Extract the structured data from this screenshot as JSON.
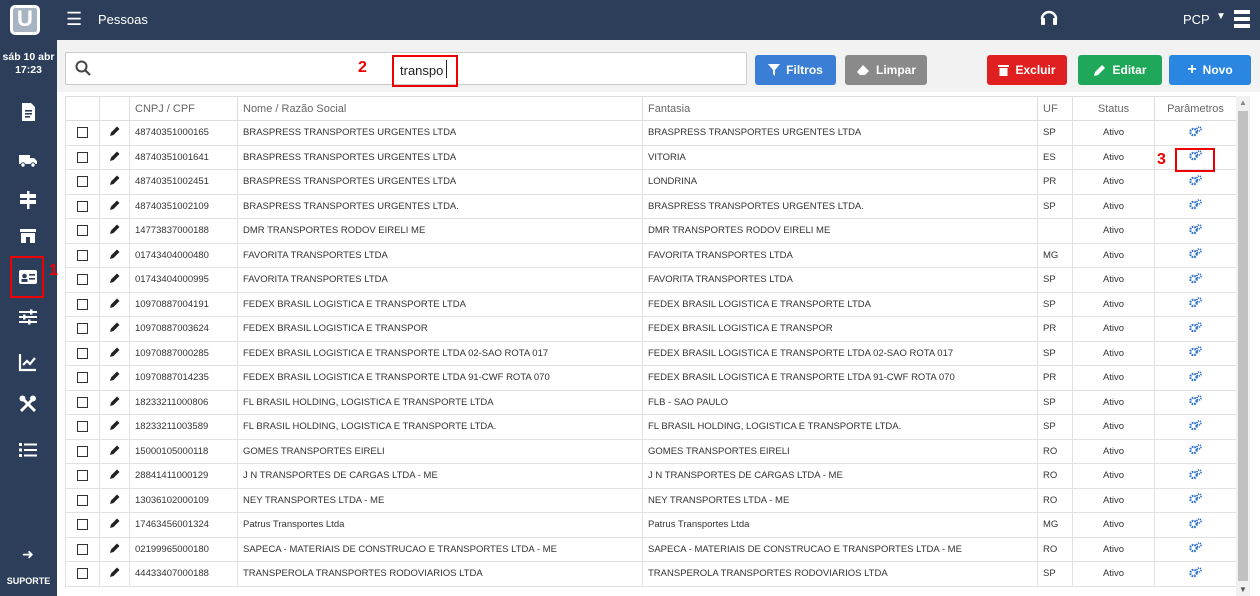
{
  "header": {
    "logo_text": "U",
    "title": "Pessoas",
    "user_label": "PCP"
  },
  "sidebar": {
    "date_line1": "sáb 10 abr",
    "date_line2": "17:23",
    "items": [
      "document-icon",
      "truck-icon",
      "signpost-icon",
      "store-icon",
      "id-card-icon",
      "sliders-icon",
      "chart-icon",
      "tools-icon",
      "list-icon"
    ],
    "support_label": "SUPORTE"
  },
  "annotations": {
    "a1": "1",
    "a2": "2",
    "a3": "3"
  },
  "search": {
    "value": "transpo"
  },
  "toolbar": {
    "filtros": "Filtros",
    "limpar": "Limpar",
    "excluir": "Excluir",
    "editar": "Editar",
    "novo": "Novo"
  },
  "table": {
    "headers": [
      "CNPJ / CPF",
      "Nome / Razão Social",
      "Fantasia",
      "UF",
      "Status",
      "Parâmetros"
    ],
    "rows": [
      [
        "48740351000165",
        "BRASPRESS TRANSPORTES URGENTES LTDA",
        "BRASPRESS TRANSPORTES URGENTES LTDA",
        "SP",
        "Ativo"
      ],
      [
        "48740351001641",
        "BRASPRESS TRANSPORTES URGENTES LTDA",
        "VITORIA",
        "ES",
        "Ativo"
      ],
      [
        "48740351002451",
        "BRASPRESS TRANSPORTES URGENTES LTDA",
        "LONDRINA",
        "PR",
        "Ativo"
      ],
      [
        "48740351002109",
        "BRASPRESS TRANSPORTES URGENTES LTDA.",
        "BRASPRESS TRANSPORTES URGENTES LTDA.",
        "SP",
        "Ativo"
      ],
      [
        "14773837000188",
        "DMR TRANSPORTES RODOV EIRELI ME",
        "DMR TRANSPORTES RODOV EIRELI ME",
        "",
        "Ativo"
      ],
      [
        "01743404000480",
        "FAVORITA TRANSPORTES LTDA",
        "FAVORITA TRANSPORTES LTDA",
        "MG",
        "Ativo"
      ],
      [
        "01743404000995",
        "FAVORITA TRANSPORTES LTDA",
        "FAVORITA TRANSPORTES LTDA",
        "SP",
        "Ativo"
      ],
      [
        "10970887004191",
        "FEDEX BRASIL LOGISTICA E TRANSPORTE LTDA",
        "FEDEX BRASIL LOGISTICA E TRANSPORTE LTDA",
        "SP",
        "Ativo"
      ],
      [
        "10970887003624",
        "FEDEX BRASIL LOGISTICA E TRANSPOR",
        "FEDEX BRASIL LOGISTICA E TRANSPOR",
        "PR",
        "Ativo"
      ],
      [
        "10970887000285",
        "FEDEX BRASIL LOGISTICA E TRANSPORTE LTDA 02-SAO ROTA 017",
        "FEDEX BRASIL LOGISTICA E TRANSPORTE LTDA 02-SAO ROTA 017",
        "SP",
        "Ativo"
      ],
      [
        "10970887014235",
        "FEDEX BRASIL LOGISTICA E TRANSPORTE LTDA 91-CWF ROTA 070",
        "FEDEX BRASIL LOGISTICA E TRANSPORTE LTDA 91-CWF ROTA 070",
        "PR",
        "Ativo"
      ],
      [
        "18233211000806",
        "FL BRASIL HOLDING, LOGISTICA E TRANSPORTE LTDA",
        "FLB - SAO PAULO",
        "SP",
        "Ativo"
      ],
      [
        "18233211003589",
        "FL BRASIL HOLDING, LOGISTICA E TRANSPORTE LTDA.",
        "FL BRASIL HOLDING, LOGISTICA E TRANSPORTE LTDA.",
        "SP",
        "Ativo"
      ],
      [
        "15000105000118",
        "GOMES TRANSPORTES EIRELI",
        "GOMES TRANSPORTES EIRELI",
        "RO",
        "Ativo"
      ],
      [
        "28841411000129",
        "J N TRANSPORTES DE CARGAS LTDA - ME",
        "J N TRANSPORTES DE CARGAS LTDA - ME",
        "RO",
        "Ativo"
      ],
      [
        "13036102000109",
        "NEY TRANSPORTES LTDA - ME",
        "NEY TRANSPORTES LTDA - ME",
        "RO",
        "Ativo"
      ],
      [
        "17463456001324",
        "Patrus Transportes Ltda",
        "Patrus Transportes Ltda",
        "MG",
        "Ativo"
      ],
      [
        "02199965000180",
        "SAPECA - MATERIAIS DE CONSTRUCAO E TRANSPORTES LTDA - ME",
        "SAPECA - MATERIAIS DE CONSTRUCAO E TRANSPORTES LTDA - ME",
        "RO",
        "Ativo"
      ],
      [
        "44433407000188",
        "TRANSPEROLA TRANSPORTES RODOVIARIOS LTDA",
        "TRANSPEROLA TRANSPORTES RODOVIARIOS LTDA",
        "SP",
        "Ativo"
      ]
    ]
  }
}
